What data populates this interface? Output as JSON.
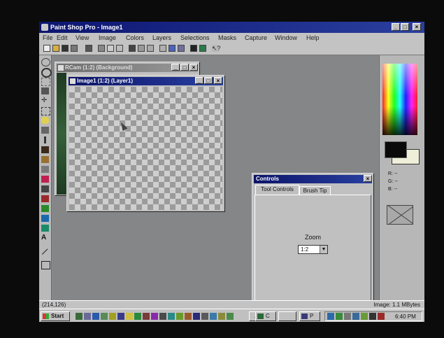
{
  "app": {
    "title": "Paint Shop Pro - Image1"
  },
  "menu": [
    "File",
    "Edit",
    "View",
    "Image",
    "Colors",
    "Layers",
    "Selections",
    "Masks",
    "Capture",
    "Window",
    "Help"
  ],
  "windows": {
    "back": {
      "title": "RCam (1:2) (Background)"
    },
    "front": {
      "title": "Image1 (1:2) (Layer1)"
    }
  },
  "controls": {
    "title": "Controls",
    "tabs": [
      "Tool Controls",
      "Brush Tip"
    ],
    "zoom_label": "Zoom",
    "zoom_value": "1:2"
  },
  "palette": {
    "readouts": [
      "R: --",
      "G: --",
      "B: --"
    ]
  },
  "status": {
    "coords": "(214,126)",
    "memory": "Image: 1.1 MBytes"
  },
  "taskbar": {
    "start_label": "Start",
    "clock": "6:40 PM",
    "tasks": [
      "C",
      "P"
    ]
  },
  "colors": {
    "titlebar": "#0d1570",
    "workspace": "#848688",
    "chrome": "#c0c0c0"
  }
}
